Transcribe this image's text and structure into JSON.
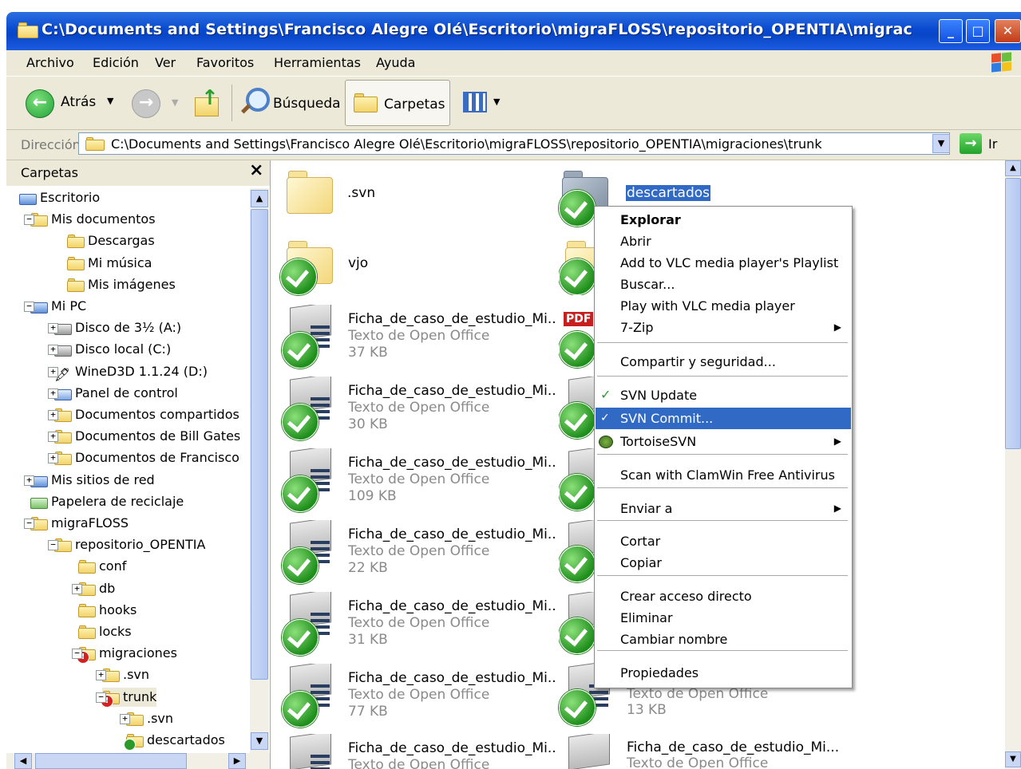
{
  "window": {
    "title": "C:\\Documents and Settings\\Francisco Alegre Olé\\Escritorio\\migraFLOSS\\repositorio_OPENTIA\\migrac"
  },
  "menu": [
    "Archivo",
    "Edición",
    "Ver",
    "Favoritos",
    "Herramientas",
    "Ayuda"
  ],
  "toolbar": {
    "back": "Atrás",
    "search": "Búsqueda",
    "folders": "Carpetas"
  },
  "address": {
    "label": "Dirección",
    "value": "C:\\Documents and Settings\\Francisco Alegre Olé\\Escritorio\\migraFLOSS\\repositorio_OPENTIA\\migraciones\\trunk",
    "go": "Ir"
  },
  "folderpane": {
    "title": "Carpetas",
    "close": "×",
    "items": [
      {
        "label": "Escritorio",
        "pm": "",
        "icon": "desktop-icon"
      },
      {
        "label": "Mis documentos",
        "pm": "−",
        "icon": "my-documents-icon"
      },
      {
        "label": "Descargas",
        "pm": "",
        "icon": "folder-icon"
      },
      {
        "label": "Mi música",
        "pm": "",
        "icon": "music-folder-icon"
      },
      {
        "label": "Mis imágenes",
        "pm": "",
        "icon": "pictures-folder-icon"
      },
      {
        "label": "Mi PC",
        "pm": "−",
        "icon": "computer-icon"
      },
      {
        "label": "Disco de 3½ (A:)",
        "pm": "+",
        "icon": "floppy-icon"
      },
      {
        "label": "Disco local (C:)",
        "pm": "+",
        "icon": "hard-drive-icon"
      },
      {
        "label": "WineD3D 1.1.24 (D:)",
        "pm": "+",
        "icon": "cd-drive-icon"
      },
      {
        "label": "Panel de control",
        "pm": "+",
        "icon": "control-panel-icon"
      },
      {
        "label": "Documentos compartidos",
        "pm": "+",
        "icon": "folder-icon"
      },
      {
        "label": "Documentos de Bill Gates",
        "pm": "+",
        "icon": "folder-icon"
      },
      {
        "label": "Documentos de Francisco",
        "pm": "+",
        "icon": "folder-icon"
      },
      {
        "label": "Mis sitios de red",
        "pm": "+",
        "icon": "network-icon"
      },
      {
        "label": "Papelera de reciclaje",
        "pm": "",
        "icon": "recycle-bin-icon"
      },
      {
        "label": "migraFLOSS",
        "pm": "−",
        "icon": "folder-icon"
      },
      {
        "label": "repositorio_OPENTIA",
        "pm": "−",
        "icon": "folder-icon"
      },
      {
        "label": "conf",
        "pm": "",
        "icon": "folder-icon"
      },
      {
        "label": "db",
        "pm": "+",
        "icon": "folder-icon"
      },
      {
        "label": "hooks",
        "pm": "",
        "icon": "folder-icon"
      },
      {
        "label": "locks",
        "pm": "",
        "icon": "folder-icon"
      },
      {
        "label": "migraciones",
        "pm": "−",
        "icon": "svn-modified-folder-icon"
      },
      {
        "label": ".svn",
        "pm": "+",
        "icon": "folder-icon"
      },
      {
        "label": "trunk",
        "pm": "−",
        "icon": "svn-modified-folder-icon"
      },
      {
        "label": ".svn",
        "pm": "+",
        "icon": "folder-icon"
      },
      {
        "label": "descartados",
        "pm": "",
        "icon": "svn-folder-icon"
      }
    ]
  },
  "content": {
    "items": [
      {
        "name": ".svn",
        "type": "",
        "size": ""
      },
      {
        "name": "descartados",
        "type": "",
        "size": ""
      },
      {
        "name": "vjo",
        "type": "",
        "size": ""
      },
      {
        "name": "Ficha_de_caso_de_estudio_Mi...",
        "type": "Texto de Open Office",
        "size": "37 KB"
      },
      {
        "name": "Ficha_de_caso_de_estudio_Mi...",
        "type": "Texto de Open Office",
        "size": "30 KB"
      },
      {
        "name": "Ficha_de_caso_de_estudio_Mi...",
        "type": "Texto de Open Office",
        "size": "109 KB"
      },
      {
        "name": "Ficha_de_caso_de_estudio_Mi...",
        "type": "Texto de Open Office",
        "size": "22 KB"
      },
      {
        "name": "Ficha_de_caso_de_estudio_Mi...",
        "type": "Texto de Open Office",
        "size": "31 KB"
      },
      {
        "name": "Ficha_de_caso_de_estudio_Mi...",
        "type": "Texto de Open Office",
        "size": "77 KB"
      },
      {
        "name": "Ficha_de_caso_de_estudio_Mi...",
        "type": "Texto de Open Office",
        "size": ""
      },
      {
        "name": "",
        "type": "Texto de Open Office",
        "size": "13 KB"
      },
      {
        "name": "Ficha_de_caso_de_estudio_Mi...",
        "type": "Texto de Open Office",
        "size": ""
      }
    ],
    "pdf_badge": "PDF"
  },
  "context_menu": {
    "items": [
      {
        "label": "Explorar",
        "bold": true
      },
      {
        "label": "Abrir"
      },
      {
        "label": "Add to VLC media player's Playlist"
      },
      {
        "label": "Buscar..."
      },
      {
        "label": "Play with VLC media player"
      },
      {
        "label": "7-Zip",
        "submenu": true
      },
      {
        "label": "Compartir y seguridad..."
      },
      {
        "label": "SVN Update",
        "icon": "svn-update-icon"
      },
      {
        "label": "SVN Commit...",
        "icon": "svn-commit-icon",
        "highlighted": true
      },
      {
        "label": "TortoiseSVN",
        "icon": "tortoisesvn-icon",
        "submenu": true
      },
      {
        "label": "Scan with ClamWin Free Antivirus"
      },
      {
        "label": "Enviar a",
        "submenu": true
      },
      {
        "label": "Cortar"
      },
      {
        "label": "Copiar"
      },
      {
        "label": "Crear acceso directo"
      },
      {
        "label": "Eliminar"
      },
      {
        "label": "Cambiar nombre"
      },
      {
        "label": "Propiedades"
      }
    ]
  },
  "colors": {
    "selection": "#316ac5",
    "titlebar": "#0a4ad0",
    "chrome": "#ece9d8",
    "svn_check": "#1f8f1c"
  }
}
